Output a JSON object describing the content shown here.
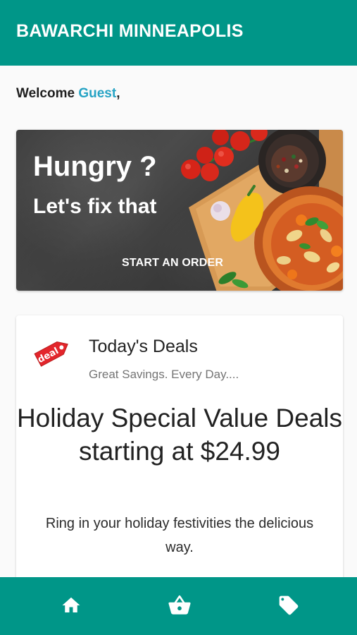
{
  "app_bar": {
    "title": "BAWARCHI MINNEAPOLIS",
    "color": "#009688"
  },
  "welcome": {
    "prefix": "Welcome ",
    "name": "Guest",
    "suffix": ","
  },
  "hero": {
    "title": "Hungry ?",
    "subtitle": "Let's fix that",
    "cta_label": "START AN ORDER"
  },
  "deals": {
    "icon": "deal-tag-icon",
    "title": "Today's Deals",
    "subtitle": "Great Savings. Every Day....",
    "headline": "Holiday Special Value Deals starting at $24.99",
    "description": "Ring in your holiday festivities the delicious way."
  },
  "bottom_nav": {
    "items": [
      {
        "icon": "home-icon"
      },
      {
        "icon": "basket-icon"
      },
      {
        "icon": "tag-icon"
      }
    ]
  }
}
